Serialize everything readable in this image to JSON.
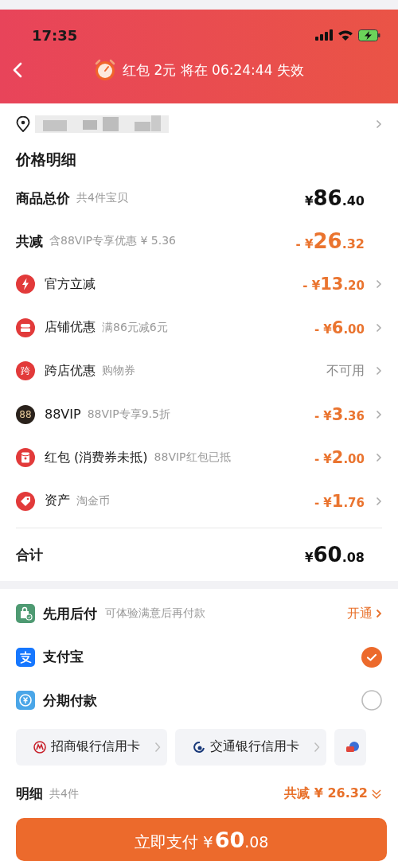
{
  "status_bar": {
    "time": "17:35"
  },
  "header": {
    "notice": "红包 2元 将在 06:24:44 失效"
  },
  "price_detail": {
    "title": "价格明细",
    "summary": [
      {
        "label": "商品总价",
        "note": "共4件宝贝",
        "prefix": "¥",
        "main": "86",
        "decimal": ".40"
      },
      {
        "label": "共减",
        "note": "含88VIP专享优惠 ¥ 5.36",
        "prefix": "- ¥",
        "main": "26",
        "decimal": ".32"
      }
    ],
    "deductions": [
      {
        "label": "官方立减",
        "kind": "amount",
        "prefix": "- ¥",
        "main": "13",
        "decimal": ".20"
      },
      {
        "label": "店铺优惠",
        "note": "满86元减6元",
        "kind": "amount",
        "prefix": "- ¥",
        "main": "6",
        "decimal": ".00"
      },
      {
        "badge": "跨",
        "label": "跨店优惠",
        "note": "购物券",
        "kind": "text",
        "value": "不可用"
      },
      {
        "badge": "88",
        "label": "88VIP",
        "note": "88VIP专享9.5折",
        "kind": "amount",
        "prefix": "- ¥",
        "main": "3",
        "decimal": ".36"
      },
      {
        "label": "红包 (消费券未抵)",
        "note": "88VIP红包已抵",
        "kind": "amount",
        "prefix": "- ¥",
        "main": "2",
        "decimal": ".00"
      },
      {
        "label": "资产",
        "note": "淘金币",
        "kind": "amount",
        "prefix": "- ¥",
        "main": "1",
        "decimal": ".76"
      }
    ],
    "total": {
      "label": "合计",
      "prefix": "¥",
      "main": "60",
      "decimal": ".08"
    }
  },
  "pay_later": {
    "label": "先用后付",
    "note": "可体验满意后再付款",
    "action": "开通"
  },
  "methods": [
    {
      "label": "支付宝",
      "selected": true
    },
    {
      "label": "分期付款",
      "selected": false
    }
  ],
  "cards": [
    {
      "kind": "full",
      "label": "招商银行信用卡"
    },
    {
      "kind": "full",
      "label": "交通银行信用卡"
    },
    {
      "kind": "cut"
    }
  ],
  "footer": {
    "label": "明细",
    "count": "共4件",
    "saving": "共减 ¥ 26.32"
  },
  "pay_button": {
    "label": "立即支付 ¥",
    "main": "60",
    "decimal": ".08"
  }
}
